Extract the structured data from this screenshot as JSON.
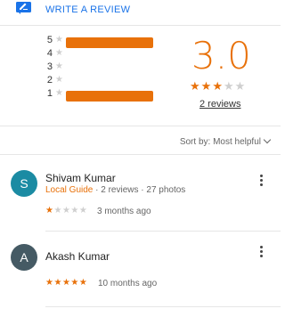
{
  "write_review": {
    "label": "WRITE A REVIEW",
    "icon": "pencil-icon",
    "color": "#1a73e8"
  },
  "histogram": {
    "rows": [
      {
        "stars": "5",
        "fraction": 1.0
      },
      {
        "stars": "4",
        "fraction": 0.0
      },
      {
        "stars": "3",
        "fraction": 0.0
      },
      {
        "stars": "2",
        "fraction": 0.0
      },
      {
        "stars": "1",
        "fraction": 1.0
      }
    ],
    "bar_color": "#e8710a"
  },
  "summary": {
    "score": "3.0",
    "rating": 3,
    "max_rating": 5,
    "reviews_label": "2 reviews",
    "accent": "#e8710a"
  },
  "sort": {
    "label": "Sort by:",
    "value": "Most helpful"
  },
  "reviews": [
    {
      "initial": "S",
      "avatar_color": "#1b8ba3",
      "name": "Shivam Kumar",
      "guide_label": "Local Guide",
      "meta": " · 2 reviews · 27 photos",
      "rating": 1,
      "time": "3 months ago"
    },
    {
      "initial": "A",
      "avatar_color": "#455a64",
      "name": "Akash Kumar",
      "guide_label": "",
      "meta": "",
      "rating": 5,
      "time": "10 months ago"
    }
  ]
}
